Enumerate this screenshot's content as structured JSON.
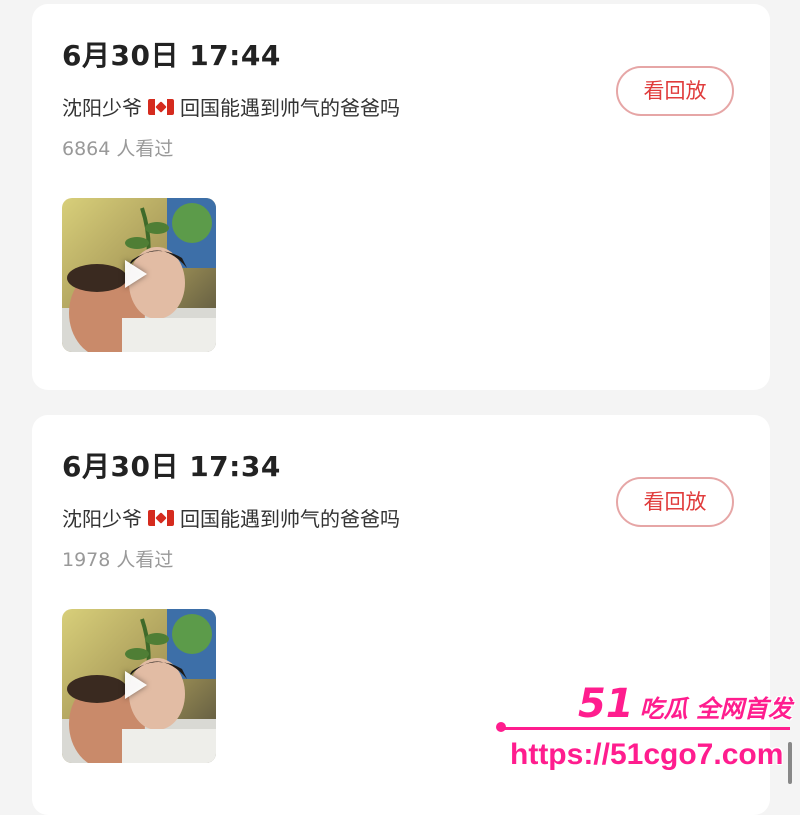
{
  "sessions": [
    {
      "time": "6月30日 17:44",
      "title_prefix": "沈阳少爷",
      "title_suffix": "回国能遇到帅气的爸爸吗",
      "viewers": "6864 人看过",
      "replay_label": "看回放"
    },
    {
      "time": "6月30日 17:34",
      "title_prefix": "沈阳少爷",
      "title_suffix": "回国能遇到帅气的爸爸吗",
      "viewers": "1978 人看过",
      "replay_label": "看回放"
    }
  ],
  "watermark": {
    "line1_num": "51",
    "line1_text": "吃瓜 全网首发",
    "line2": "https://51cgo7.com"
  },
  "colors": {
    "accent": "#e03c3c",
    "watermark": "#ff1d8e",
    "background": "#f4f4f4"
  },
  "icons": [
    "canada-flag-icon",
    "play-icon"
  ]
}
